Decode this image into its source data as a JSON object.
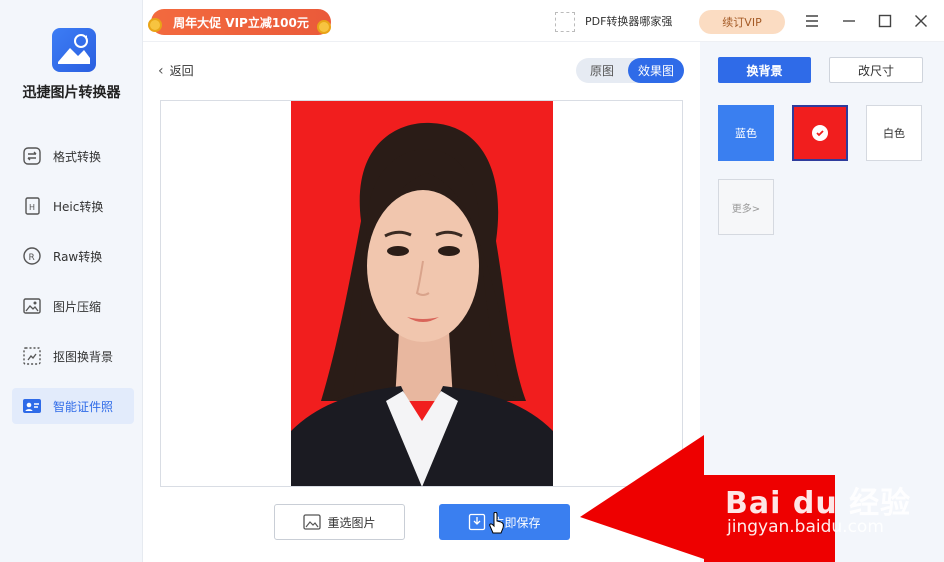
{
  "app": {
    "name": "迅捷图片转换器"
  },
  "sidebar": {
    "items": [
      {
        "label": "格式转换",
        "icon": "format-convert-icon"
      },
      {
        "label": "Heic转换",
        "icon": "heic-icon"
      },
      {
        "label": "Raw转换",
        "icon": "raw-icon"
      },
      {
        "label": "图片压缩",
        "icon": "image-compress-icon"
      },
      {
        "label": "抠图换背景",
        "icon": "cutout-icon"
      },
      {
        "label": "智能证件照",
        "icon": "id-photo-icon",
        "active": true
      }
    ]
  },
  "topbar": {
    "promo": "周年大促 VIP立减100元",
    "pdf_text": "PDF转换器哪家强",
    "vip_button": "续订VIP"
  },
  "main": {
    "back_label": "返回",
    "view_toggle": {
      "original": "原图",
      "result": "效果图",
      "selected": "效果图"
    },
    "reselect_button": "重选图片",
    "save_button": "立即保存"
  },
  "right_panel": {
    "tabs": {
      "background": "换背景",
      "size": "改尺寸"
    },
    "colors": [
      {
        "label": "蓝色",
        "hex": "#3a7ff0"
      },
      {
        "label": "",
        "hex": "#f11e1e",
        "selected": true
      },
      {
        "label": "白色",
        "hex": "#ffffff"
      }
    ],
    "more_label": "更多>"
  },
  "watermark": {
    "brand": "Bai du 经验",
    "url": "jingyan.baidu.com"
  },
  "colors": {
    "accent": "#2f6be8",
    "photo_bg": "#f11e1e",
    "arrow": "#ee0000"
  }
}
